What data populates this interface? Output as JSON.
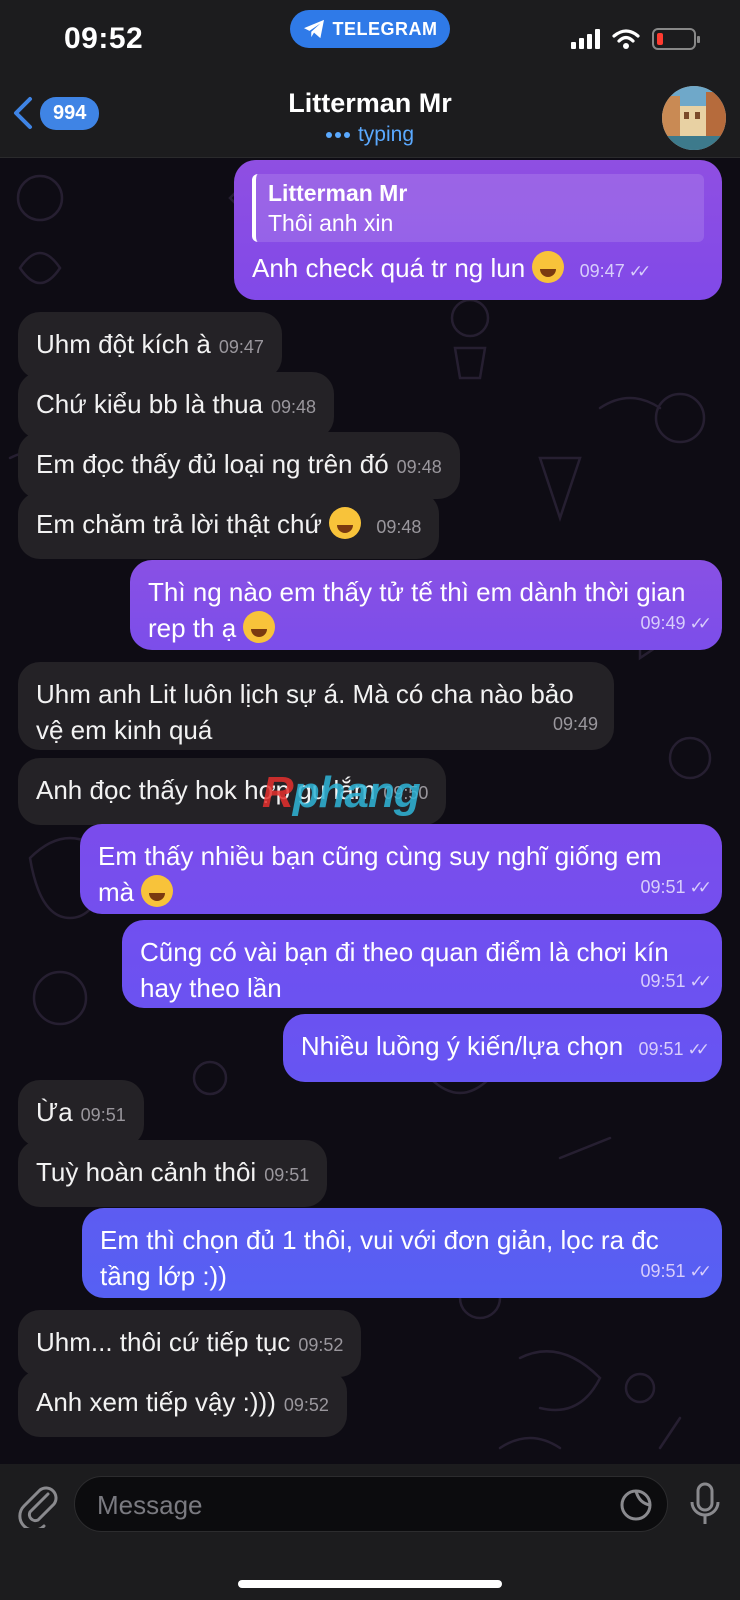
{
  "status_bar": {
    "time": "09:52",
    "app_pill": "TELEGRAM"
  },
  "header": {
    "back_count": "994",
    "title": "Litterman Mr",
    "status": "typing"
  },
  "messages": [
    {
      "dir": "out",
      "reply_name": "Litterman Mr",
      "reply_text": "Thôi anh xin",
      "text": "Anh check quá tr ng lun",
      "emoji": "tears-of-joy",
      "time": "09:47"
    },
    {
      "dir": "in",
      "text": "Uhm đột kích à",
      "time": "09:47"
    },
    {
      "dir": "in",
      "text": "Chứ kiểu bb là thua",
      "time": "09:48"
    },
    {
      "dir": "in",
      "text": "Em đọc thấy đủ loại ng trên đó",
      "time": "09:48"
    },
    {
      "dir": "in",
      "text": "Em chăm trả lời thật chứ",
      "emoji": "grinning",
      "time": "09:48"
    },
    {
      "dir": "out",
      "text": "Thì ng nào em thấy tử tế thì em dành thời gian rep th ạ",
      "emoji": "tears-of-joy",
      "time": "09:49"
    },
    {
      "dir": "in",
      "text": "Uhm anh Lit luôn lịch sự á. Mà có cha nào bảo vệ em kinh quá",
      "time": "09:49"
    },
    {
      "dir": "in",
      "text": "Anh đọc thấy hok hợp gu lắm",
      "time": "09:50"
    },
    {
      "dir": "out",
      "text": "Em thấy nhiều bạn cũng cùng suy nghĩ giống em mà",
      "emoji": "tears-of-joy",
      "time": "09:51"
    },
    {
      "dir": "out",
      "text": "Cũng có vài bạn đi theo quan điểm là chơi kín hay theo lần",
      "time": "09:51"
    },
    {
      "dir": "out",
      "text": "Nhiều luồng ý kiến/lựa chọn",
      "time": "09:51"
    },
    {
      "dir": "in",
      "text": "Ừa",
      "time": "09:51"
    },
    {
      "dir": "in",
      "text": "Tuỳ hoàn cảnh thôi",
      "time": "09:51"
    },
    {
      "dir": "out",
      "text": "Em thì chọn đủ 1 thôi, vui với đơn giản, lọc ra đc tầng lớp :))",
      "time": "09:51"
    },
    {
      "dir": "in",
      "text": "Uhm... thôi cứ tiếp tục",
      "time": "09:52"
    },
    {
      "dir": "in",
      "text": "Anh xem tiếp vậy :)))",
      "time": "09:52"
    }
  ],
  "watermark": {
    "text": "phang"
  },
  "composer": {
    "placeholder": "Message"
  },
  "colors": {
    "accent": "#3f84e5",
    "typing": "#5aa9ff",
    "incoming_bubble": "#242226",
    "outgoing_gradient_top": "#8d4fe6",
    "outgoing_gradient_bottom": "#5a63f0"
  }
}
